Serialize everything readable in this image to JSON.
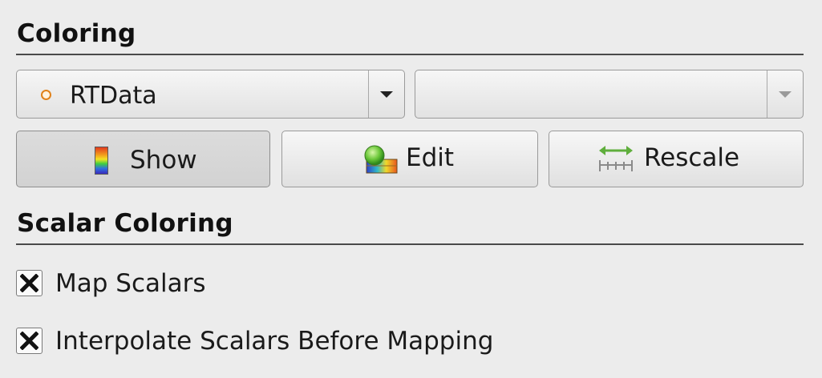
{
  "coloring": {
    "title": "Coloring",
    "array_combo": {
      "value": "RTData",
      "icon": "point-data-icon"
    },
    "component_combo": {
      "value": ""
    },
    "buttons": {
      "show_label": "Show",
      "show_icon": "color-legend-icon",
      "edit_label": "Edit",
      "edit_icon": "edit-colormap-icon",
      "rescale_label": "Rescale",
      "rescale_icon": "rescale-range-icon"
    }
  },
  "scalar_coloring": {
    "title": "Scalar Coloring",
    "map_scalars": {
      "label": "Map Scalars",
      "checked": true
    },
    "interpolate_scalars": {
      "label": "Interpolate Scalars Before Mapping",
      "checked": true
    }
  },
  "colors": {
    "background": "#ececec",
    "point_icon": "#e0821a"
  }
}
